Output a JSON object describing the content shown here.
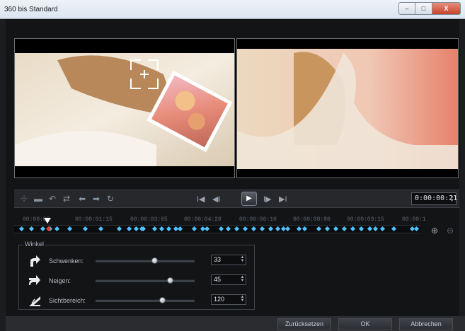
{
  "window": {
    "title": "360 bis Standard",
    "buttons": {
      "minimize": "–",
      "maximize": "□",
      "close": "X"
    }
  },
  "toolbar": {
    "icons": [
      "add-keyframe-icon",
      "remove-keyframe-icon",
      "reverse-keyframes-icon",
      "swap-icon",
      "move-left-icon",
      "move-right-icon",
      "go-to-keyframe-icon"
    ],
    "playback": {
      "first": "I◀",
      "prev": "◀I",
      "play": "▶",
      "next": "I▶",
      "last": "▶I"
    },
    "timecode": "0:00:00:21"
  },
  "timeline": {
    "ticks": [
      "00:00:00",
      "00:00:01:15",
      "00:00:03:05",
      "00:00:04:20",
      "00:00:06:10",
      "00:00:08:00",
      "00:00:09:15",
      "00:00:1"
    ],
    "playhead_fraction": 0.083,
    "zoom_in": "⊕",
    "zoom_out": "⊖"
  },
  "winkel": {
    "legend": "Winkel",
    "rows": [
      {
        "label": "Schwenken:",
        "value": "33",
        "slider_fraction": 0.59,
        "icon": "pan-arrow-icon"
      },
      {
        "label": "Neigen:",
        "value": "45",
        "slider_fraction": 0.75,
        "icon": "tilt-arrow-icon"
      },
      {
        "label": "Sichtbereich:",
        "value": "120",
        "slider_fraction": 0.67,
        "icon": "field-of-view-icon"
      }
    ]
  },
  "footer": {
    "reset": "Zurücksetzen",
    "ok": "OK",
    "cancel": "Abbrechen"
  },
  "colors": {
    "keyframe": "#4fc3ff",
    "playhead": "#e53b2c",
    "background": "#131416"
  }
}
